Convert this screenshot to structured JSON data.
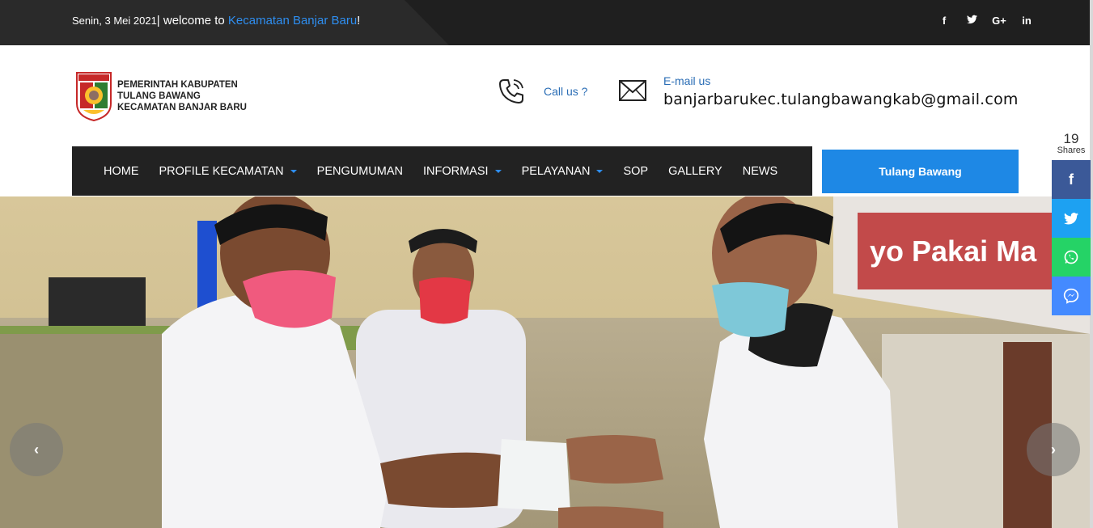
{
  "topbar": {
    "date": "Senin, 3 Mei 2021",
    "separator": "|",
    "welcome": " welcome to ",
    "site_name": "Kecamatan Banjar Baru",
    "bang": "!",
    "social": [
      {
        "icon": "facebook-icon",
        "glyph": "f"
      },
      {
        "icon": "twitter-icon",
        "glyph": "🐦"
      },
      {
        "icon": "google-plus-icon",
        "glyph": "G+"
      },
      {
        "icon": "linkedin-icon",
        "glyph": "in"
      }
    ]
  },
  "header": {
    "logo_lines": [
      "PEMERINTAH KABUPATEN",
      "TULANG BAWANG",
      "KECAMATAN BANJAR BARU"
    ],
    "crest_text": "TULANG BAWANG",
    "call_label": "Call us ?",
    "email_label": "E-mail us",
    "email": "banjarbarukec.tulangbawangkab@gmail.com"
  },
  "nav": {
    "items": [
      {
        "label": "HOME",
        "dropdown": false
      },
      {
        "label": "PROFILE KECAMATAN",
        "dropdown": true
      },
      {
        "label": "PENGUMUMAN",
        "dropdown": false
      },
      {
        "label": "INFORMASI",
        "dropdown": true
      },
      {
        "label": "PELAYANAN",
        "dropdown": true
      },
      {
        "label": "SOP",
        "dropdown": false
      },
      {
        "label": "GALLERY",
        "dropdown": false
      },
      {
        "label": "NEWS",
        "dropdown": false
      }
    ],
    "cta": "Tulang Bawang"
  },
  "share_rail": {
    "count": "19",
    "label": "Shares",
    "buttons": [
      {
        "icon": "facebook-icon",
        "color": "#3b5998"
      },
      {
        "icon": "twitter-icon",
        "color": "#1da1f2"
      },
      {
        "icon": "whatsapp-icon",
        "color": "#25d366"
      },
      {
        "icon": "messenger-icon",
        "color": "#448aff"
      }
    ]
  },
  "hero": {
    "banner_text": "yo Pakai Ma"
  },
  "colors": {
    "accent": "#1e88e5",
    "link": "#2e8ef0",
    "dark_bar": "#1f1f1f"
  }
}
